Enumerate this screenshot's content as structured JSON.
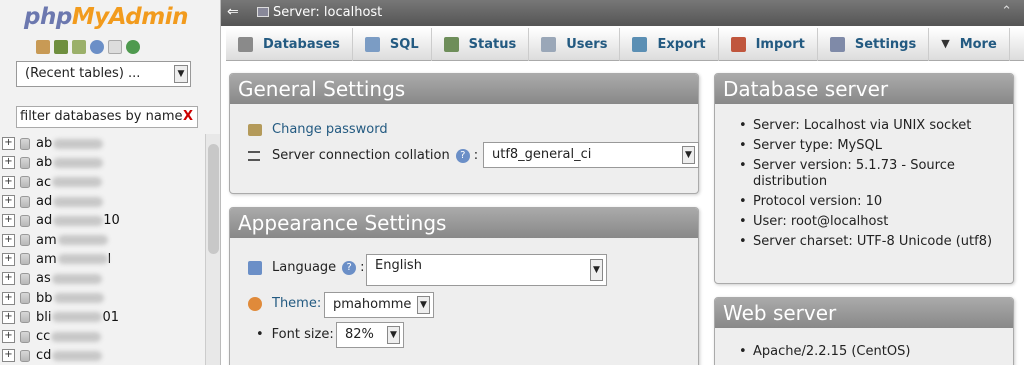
{
  "logo": {
    "php": "php",
    "my": "My",
    "admin": "Admin"
  },
  "nav": {
    "recent_tables": "(Recent tables) ...",
    "filter_placeholder": "filter databases by name",
    "databases": [
      {
        "prefix": "ab"
      },
      {
        "prefix": "ab"
      },
      {
        "prefix": "ac"
      },
      {
        "prefix": "ad"
      },
      {
        "prefix": "ad",
        "suffix": "10"
      },
      {
        "prefix": "am"
      },
      {
        "prefix": "am",
        "suffix": "l"
      },
      {
        "prefix": "as"
      },
      {
        "prefix": "bb"
      },
      {
        "prefix": "bli",
        "suffix": "01"
      },
      {
        "prefix": "cc"
      },
      {
        "prefix": "cd"
      }
    ]
  },
  "topbar": {
    "server": "Server: localhost"
  },
  "menu": [
    {
      "label": "Databases",
      "icon": "databases-icon",
      "color": "#8a8a8a"
    },
    {
      "label": "SQL",
      "icon": "sql-icon",
      "color": "#7b9cc4"
    },
    {
      "label": "Status",
      "icon": "status-icon",
      "color": "#6e8e5a"
    },
    {
      "label": "Users",
      "icon": "users-icon",
      "color": "#9aa7b8"
    },
    {
      "label": "Export",
      "icon": "export-icon",
      "color": "#5b8fb4"
    },
    {
      "label": "Import",
      "icon": "import-icon",
      "color": "#c0563d"
    },
    {
      "label": "Settings",
      "icon": "wrench-icon",
      "color": "#7f8aa8"
    },
    {
      "label": "More",
      "icon": "caret-down-icon",
      "color": "#333333"
    }
  ],
  "general": {
    "title": "General Settings",
    "change_password": "Change password",
    "collation_label": "Server connection collation",
    "collation_value": "utf8_general_ci"
  },
  "appearance": {
    "title": "Appearance Settings",
    "language_label": "Language",
    "language_value": "English",
    "theme_label": "Theme:",
    "theme_value": "pmahomme",
    "font_label": "Font size:",
    "font_value": "82%"
  },
  "db_server": {
    "title": "Database server",
    "items": [
      "Server: Localhost via UNIX socket",
      "Server type: MySQL",
      "Server version: 5.1.73 - Source distribution",
      "Protocol version: 10",
      "User: root@localhost",
      "Server charset: UTF-8 Unicode (utf8)"
    ]
  },
  "web_server": {
    "title": "Web server",
    "items": [
      "Apache/2.2.15 (CentOS)"
    ]
  }
}
